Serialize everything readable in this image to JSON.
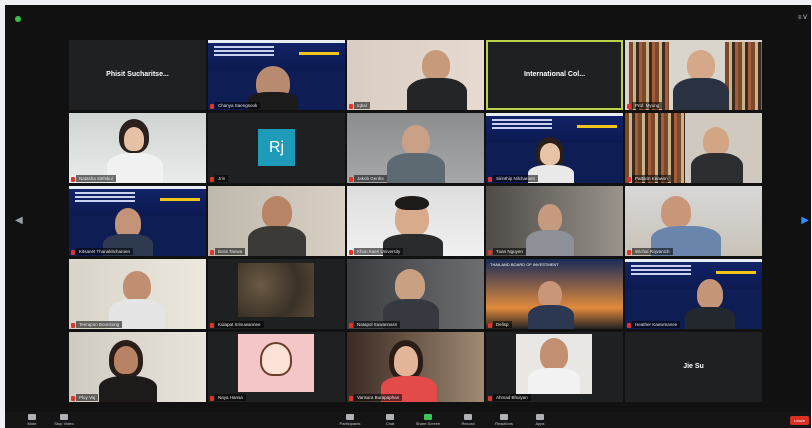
{
  "window": {
    "view_button_label": "≡ V"
  },
  "tiles": [
    {
      "name": "Phisit Sucharitse...",
      "center_name": "Phisit Sucharitse...",
      "label": ""
    },
    {
      "name": "Chanya Saengsook",
      "label": "Chanya Saengsook"
    },
    {
      "name": "Iqbal",
      "label": "Iqbal"
    },
    {
      "name": "International Col...",
      "center_name": "International Col...",
      "label": ""
    },
    {
      "name": "Prof. Myung",
      "label": "Prof. Myung"
    },
    {
      "name": "Natasha Sitthikul",
      "label": "Natasha Sitthikul"
    },
    {
      "name": "Jrin",
      "label": "Jrin",
      "avatar_text": "Rj"
    },
    {
      "name": "Jakob Gerdts",
      "label": "Jakob Gerdts"
    },
    {
      "name": "Sirinthip Nilcharoen",
      "label": "Sirinthip Nilcharoen"
    },
    {
      "name": "Pattarin Keawsri",
      "label": "Pattarin Keawsri"
    },
    {
      "name": "Kitsanet Thanakitcharoen",
      "label": "Kitsanet Thanakitcharoen"
    },
    {
      "name": "Boss Tanwa",
      "label": "Boss Tanwa"
    },
    {
      "name": "Khon Kaen University",
      "label": "Khon Kaen University"
    },
    {
      "name": "Tuan Nguyen",
      "label": "Tuan Nguyen"
    },
    {
      "name": "Wichai Rojvanich",
      "label": "Wichai Rojvanich"
    },
    {
      "name": "Teerapon Boonsong",
      "label": "Teerapon Boonsong"
    },
    {
      "name": "Kulapat Srisuwannee",
      "label": "Kulapat Srisuwannee"
    },
    {
      "name": "Natapol Suwannasri",
      "label": "Natapol Suwannasri"
    },
    {
      "name": "Delisp",
      "label": "Delisp",
      "banner_text": "THAILAND BOARD OF INVESTMENT"
    },
    {
      "name": "Heather Kaewmanee",
      "label": "Heather Kaewmanee"
    },
    {
      "name": "Ploy Vaj",
      "label": "Ploy Vaj"
    },
    {
      "name": "Naya Hansa",
      "label": "Naya Hansa"
    },
    {
      "name": "Varisara Burapaphan",
      "label": "Varisara Burapaphan"
    },
    {
      "name": "Ahmad Bhuiyan",
      "label": "Ahmad Bhuiyan"
    },
    {
      "name": "Jie Su",
      "center_name": "Jie Su",
      "label": ""
    }
  ],
  "toolbar": {
    "mute": "Mute",
    "video": "Stop Video",
    "participants": "Participants",
    "participants_count": "25",
    "chat": "Chat",
    "share": "Share Screen",
    "record": "Record",
    "reactions": "Reactions",
    "apps": "Apps",
    "leave": "Leave"
  }
}
